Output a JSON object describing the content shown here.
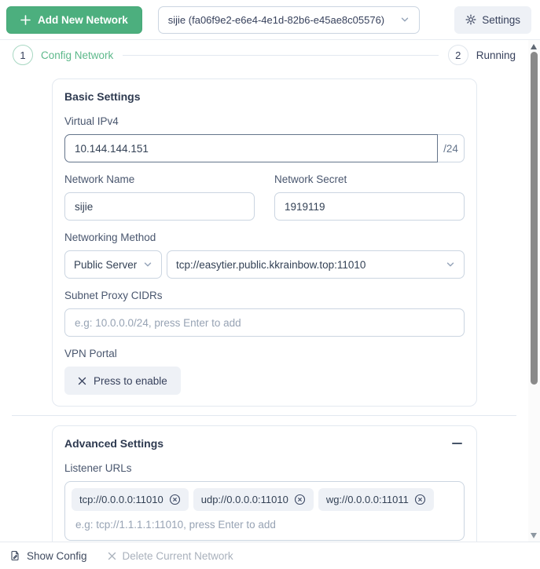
{
  "header": {
    "add_button": {
      "label": "Add New Network",
      "icon": "plus-icon"
    },
    "network_select": {
      "value": "sijie (fa06f9e2-e6e4-4e1d-82b6-e45ae8c05576)",
      "icon": "chevron-down-icon"
    },
    "settings_button": {
      "label": "Settings",
      "icon": "gear-icon"
    }
  },
  "steps": {
    "step1": {
      "number": "1",
      "label": "Config Network"
    },
    "step2": {
      "number": "2",
      "label": "Running"
    }
  },
  "basic": {
    "title": "Basic Settings",
    "virtual_ipv4": {
      "label": "Virtual IPv4",
      "value": "10.144.144.151",
      "suffix": "/24"
    },
    "network_name": {
      "label": "Network Name",
      "value": "sijie"
    },
    "network_secret": {
      "label": "Network Secret",
      "value": "1919119"
    },
    "networking_method": {
      "label": "Networking Method",
      "method_value": "Public Server",
      "server_value": "tcp://easytier.public.kkrainbow.top:11010"
    },
    "subnet_proxy": {
      "label": "Subnet Proxy CIDRs",
      "placeholder": "e.g: 10.0.0.0/24, press Enter to add"
    },
    "vpn_portal": {
      "label": "VPN Portal",
      "button_label": "Press to enable",
      "icon": "x-icon"
    }
  },
  "advanced": {
    "title": "Advanced Settings",
    "collapse_icon": "minus-icon",
    "listener_urls": {
      "label": "Listener URLs",
      "chips": [
        "tcp://0.0.0.0:11010",
        "udp://0.0.0.0:11010",
        "wg://0.0.0.0:11011"
      ],
      "chip_remove_icon": "circle-x-icon",
      "placeholder": "e.g: tcp://1.1.1.1:11010, press Enter to add"
    }
  },
  "footer": {
    "show_config_label": "Show Config",
    "show_config_icon": "file-edit-icon",
    "delete_label": "Delete Current Network",
    "delete_icon": "x-icon"
  },
  "colors": {
    "accent_green": "#4caf7e",
    "step_active_green": "#5cb88a",
    "text_dark": "#2e3a50",
    "text_label": "#49566e",
    "placeholder": "#97a3b4",
    "border_input": "#cbd5e1",
    "border_focused": "#64748b",
    "soft_button_bg": "#eef1f6",
    "scrollbar_thumb": "#8a8a8a"
  }
}
